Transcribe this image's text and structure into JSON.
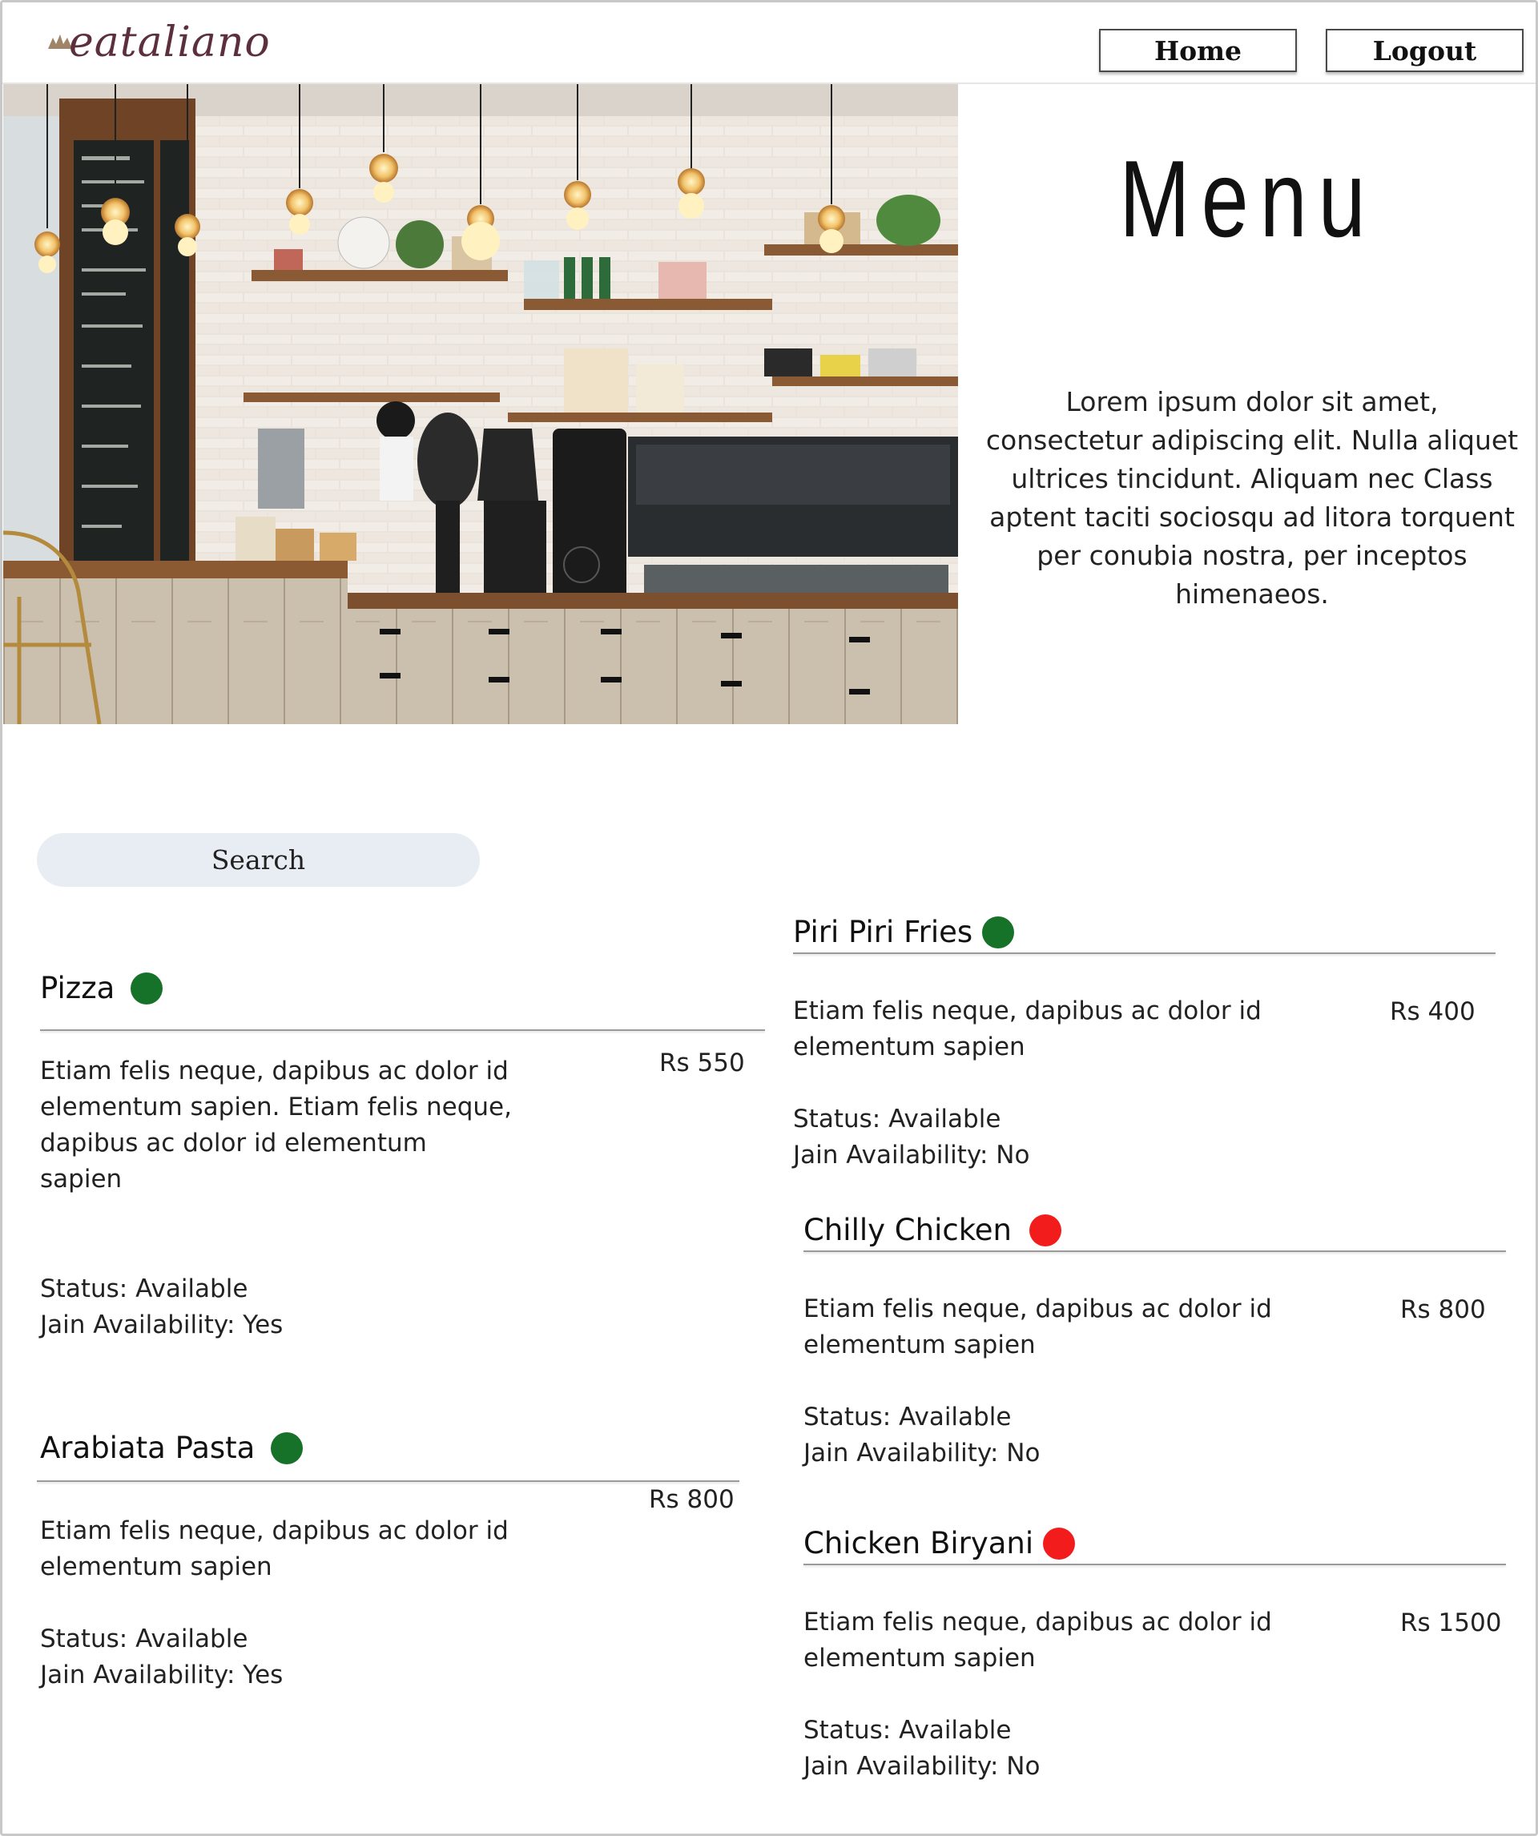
{
  "header": {
    "logo_text": "eataliano",
    "nav": {
      "home": "Home",
      "logout": "Logout"
    }
  },
  "hero": {
    "image": "cafe counter photo"
  },
  "page": {
    "title": "Menu",
    "intro": "Lorem ipsum dolor sit amet, consectetur adipiscing elit. Nulla aliquet ultrices tincidunt. Aliquam nec Class aptent taciti sociosqu ad litora torquent per conubia nostra, per inceptos himenaeos."
  },
  "search": {
    "label": "Search"
  },
  "colors": {
    "veg": "#167229",
    "non_veg": "#f21c1c",
    "search_bg": "#e7edf2"
  },
  "items": [
    {
      "name": "Pizza",
      "type": "veg",
      "description": "Etiam felis neque, dapibus ac dolor id elementum sapien. Etiam felis neque, dapibus ac dolor id elementum sapien",
      "price": "Rs 550",
      "status": "Status: Available",
      "jain": "Jain Availability: Yes"
    },
    {
      "name": "Arabiata Pasta",
      "type": "veg",
      "description": "Etiam felis neque, dapibus ac dolor id elementum sapien",
      "price": "Rs 800",
      "status": "Status: Available",
      "jain": "Jain Availability: Yes"
    },
    {
      "name": "Piri Piri Fries",
      "type": "veg",
      "description": "Etiam felis neque, dapibus ac dolor id elementum sapien",
      "price": "Rs 400",
      "status": "Status: Available",
      "jain": "Jain Availability: No"
    },
    {
      "name": "Chilly Chicken",
      "type": "non-veg",
      "description": "Etiam felis neque, dapibus ac dolor id elementum sapien",
      "price": "Rs 800",
      "status": "Status: Available",
      "jain": "Jain Availability: No"
    },
    {
      "name": "Chicken Biryani",
      "type": "non-veg",
      "description": "Etiam felis neque, dapibus ac dolor id elementum sapien",
      "price": "Rs 1500",
      "status": "Status: Available",
      "jain": "Jain Availability: No"
    }
  ]
}
